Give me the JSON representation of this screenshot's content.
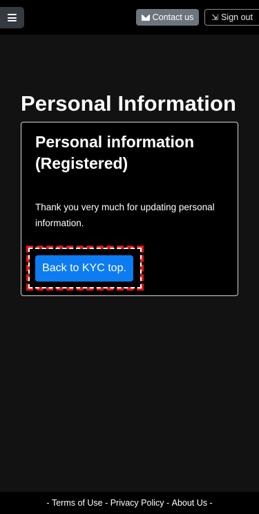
{
  "header": {
    "menu_icon": "hamburger-icon",
    "contact_label": "Contact us",
    "contact_icon": "envelope-icon",
    "signout_label": "Sign out",
    "signout_icon": "sign-out-icon",
    "colors": {
      "contact_bg": "#6c757d",
      "menu_bg": "#343a40"
    }
  },
  "main": {
    "page_title": "Personal Information",
    "card": {
      "title": "Personal information (Registered)",
      "message": "Thank you very much for updating personal information.",
      "button_label": "Back to KYC top.",
      "button_color": "#0d7bf2",
      "highlight_color": "#e01a1a"
    }
  },
  "footer": {
    "dash_start": "- ",
    "terms": "Terms of Use",
    "sep1": " - ",
    "privacy": "Privacy Policy",
    "sep2": " - ",
    "about": "About Us",
    "dash_end": " -"
  }
}
